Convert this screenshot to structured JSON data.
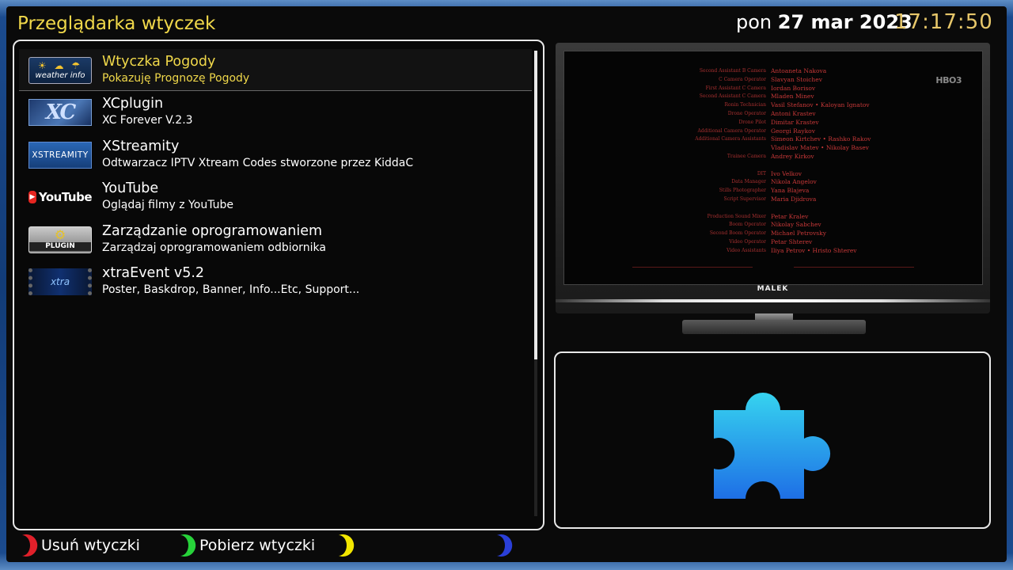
{
  "header": {
    "title": "Przeglądarka wtyczek",
    "day": "pon",
    "date": "27 mar 2023",
    "time": "17:17:50"
  },
  "plugins": [
    {
      "name": "Wtyczka Pogody",
      "description": "Pokazuję Prognozę Pogody",
      "logo_text": "weather info",
      "selected": true
    },
    {
      "name": "XCplugin",
      "description": "XC Forever V.2.3",
      "logo_text": "XC",
      "selected": false
    },
    {
      "name": "XStreamity",
      "description": "Odtwarzacz IPTV Xtream Codes stworzone przez KiddaC",
      "logo_text": "XSTREAMITY",
      "selected": false
    },
    {
      "name": "YouTube",
      "description": "Oglądaj filmy z YouTube",
      "logo_text": "YouTube",
      "selected": false
    },
    {
      "name": "Zarządzanie oprogramowaniem",
      "description": "Zarządzaj oprogramowaniem odbiornika",
      "logo_text": "PLUGIN",
      "selected": false
    },
    {
      "name": "xtraEvent v5.2",
      "description": "Poster, Baskdrop, Banner, Info...Etc, Support...",
      "logo_text": "xtra",
      "selected": false
    }
  ],
  "tv": {
    "brand": "MALEK",
    "channel_logo": "HBO3",
    "credits": [
      {
        "role": "Second Assistant B Camera",
        "who": "Antoaneta Nakova"
      },
      {
        "role": "C Camera Operator",
        "who": "Slavyan Stoichev"
      },
      {
        "role": "First Assistant C Camera",
        "who": "Iordan Borisov"
      },
      {
        "role": "Second Assistant C Camera",
        "who": "Mladen Minev"
      },
      {
        "role": "Ronin Technician",
        "who": "Vasil Stefanov • Kaloyan Ignatov"
      },
      {
        "role": "Drone Operator",
        "who": "Antoni Krastev"
      },
      {
        "role": "Drone Pilot",
        "who": "Dimitar Krastev"
      },
      {
        "role": "Additional Camera Operator",
        "who": "Georgi Raykov"
      },
      {
        "role": "Additional Camera Assistants",
        "who": "Simeon Kirtchev • Rashko Rakov"
      },
      {
        "role": "",
        "who": "Vladislav Matev • Nikolay Basev"
      },
      {
        "role": "Trainee Camera",
        "who": "Andrey Kirkov"
      },
      {
        "role": "",
        "who": ""
      },
      {
        "role": "DIT",
        "who": "Ivo Velkov"
      },
      {
        "role": "Data Manager",
        "who": "Nikola Angelov"
      },
      {
        "role": "Stills Photographer",
        "who": "Yana Blajeva"
      },
      {
        "role": "Script Supervisor",
        "who": "Maria Djidrova"
      },
      {
        "role": "",
        "who": ""
      },
      {
        "role": "Production Sound Mixer",
        "who": "Petar Kralev"
      },
      {
        "role": "Boom Operator",
        "who": "Nikolay Sabchev"
      },
      {
        "role": "Second Boom Operator",
        "who": "Michael Petrovsky"
      },
      {
        "role": "Video Operator",
        "who": "Petar Shterev"
      },
      {
        "role": "Video Assistants",
        "who": "Iliya Petrov • Hristo Shterev"
      }
    ]
  },
  "buttons": {
    "red": {
      "label": "Usuń wtyczki",
      "color": "#e0202a"
    },
    "green": {
      "label": "Pobierz wtyczki",
      "color": "#27d23a"
    },
    "yellow": {
      "label": "",
      "color": "#f2e600"
    },
    "blue": {
      "label": "",
      "color": "#2a3fd8"
    }
  },
  "colors": {
    "accent": "#f0d84a",
    "clock": "#e7c76a",
    "puzzle_top": "#36d3ef",
    "puzzle_bottom": "#1e6fe6"
  }
}
